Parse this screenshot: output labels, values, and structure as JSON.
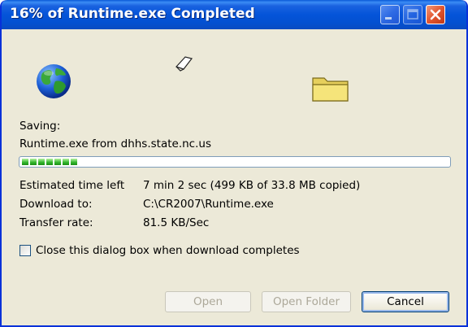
{
  "window": {
    "title": "16% of Runtime.exe Completed"
  },
  "titlebar_buttons": {
    "minimize_icon": "minimize-icon",
    "maximize_icon": "maximize-icon",
    "close_icon": "close-icon"
  },
  "animation": {
    "source_icon": "globe-icon",
    "transfer_icon": "flying-page-icon",
    "destination_icon": "folder-icon"
  },
  "status": {
    "saving_label": "Saving:",
    "file_line": "Runtime.exe from dhhs.state.nc.us"
  },
  "progress": {
    "percent": 16,
    "filled_segments": 7
  },
  "details": {
    "time_left_label": "Estimated time left",
    "time_left_value": "7 min 2 sec (499 KB of 33.8 MB copied)",
    "download_to_label": "Download to:",
    "download_to_value": "C:\\CR2007\\Runtime.exe",
    "transfer_rate_label": "Transfer rate:",
    "transfer_rate_value": "81.5 KB/Sec"
  },
  "options": {
    "close_on_complete_label": "Close this dialog box when download completes",
    "close_on_complete_checked": false
  },
  "buttons": {
    "open": "Open",
    "open_folder": "Open Folder",
    "cancel": "Cancel"
  },
  "colors": {
    "titlebar": "#0454d9",
    "dialog_bg": "#ece9d8",
    "progress_green": "#2fb32a",
    "close_button": "#e2562f"
  }
}
